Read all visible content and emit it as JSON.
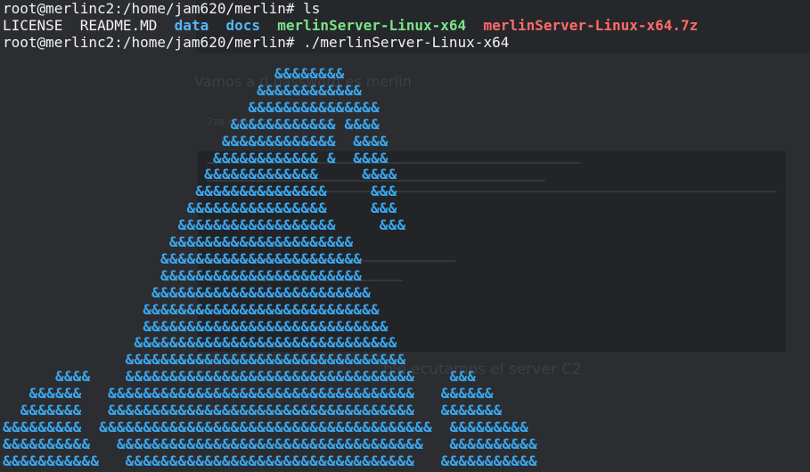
{
  "terminal": {
    "line1": {
      "prompt": "root@merlinc2:/home/jam620/merlin#",
      "command": " ls"
    },
    "ls_output": {
      "license": "LICENSE",
      "readme": "README.MD",
      "data_dir": "data",
      "docs_dir": "docs",
      "exec_file": "merlinServer-Linux-x64",
      "archive_file": "merlinServer-Linux-x64.7z"
    },
    "line3": {
      "prompt": "root@merlinc2:/home/jam620/merlin#",
      "command": " ./merlinServer-Linux-x64"
    }
  },
  "background_doc": {
    "heading_fragment": "Vamos a d                           password es merlin",
    "cmd_fragment": "7za x             x64.7z",
    "section_fragment": "ble               ecutamos el server C2"
  },
  "ascii_art": {
    "rows": [
      "                               &&&&&&&&",
      "                             &&&&&&&&&&&&",
      "                            &&&&&&&&&&&&&&&",
      "                          &&&&&&&&&&&& &&&&",
      "                         &&&&&&&&&&&&&  &&&&",
      "                        &&&&&&&&&&&& &  &&&&",
      "                       &&&&&&&&&&&&&     &&&&",
      "                      &&&&&&&&&&&&&&&     &&&",
      "                     &&&&&&&&&&&&&&&&     &&&",
      "                    &&&&&&&&&&&&&&&&&&     &&&",
      "                   &&&&&&&&&&&&&&&&&&&&&",
      "                  &&&&&&&&&&&&&&&&&&&&&&&",
      "                  &&&&&&&&&&&&&&&&&&&&&&&",
      "                 &&&&&&&&&&&&&&&&&&&&&&&&&",
      "                &&&&&&&&&&&&&&&&&&&&&&&&&&&",
      "                &&&&&&&&&&&&&&&&&&&&&&&&&&&&",
      "               &&&&&&&&&&&&&&&&&&&&&&&&&&&&&&",
      "              &&&&&&&&&&&&&&&&&&&&&&&&&&&&&&&&",
      "      &&&&    &&&&&&&&&&&&&&&&&&&&&&&&&&&&&&&&&    &&&",
      "   &&&&&&   &&&&&&&&&&&&&&&&&&&&&&&&&&&&&&&&&&&   &&&&&&",
      "  &&&&&&&   &&&&&&&&&&&&&&&&&&&&&&&&&&&&&&&&&&&   &&&&&&&",
      "&&&&&&&&&  &&&&&&&&&&&&&&&&&&&&&&&&&&&&&&&&&&&&&&  &&&&&&&&&",
      "&&&&&&&&&&   &&&&&&&&&&&&&&&&&&&&&&&&&&&&&&&&&&&   &&&&&&&&&&",
      "&&&&&&&&&&&   &&&&&&&&&&&&&&&&&&&&&&&&&&&&&&&&&   &&&&&&&&&&&"
    ]
  },
  "colors": {
    "background": "#2a2c30",
    "text": "#f2f2f2",
    "directory": "#56b6f5",
    "executable": "#7be38a",
    "archive": "#ff6b6b",
    "ascii_art": "#3aa8ef"
  }
}
